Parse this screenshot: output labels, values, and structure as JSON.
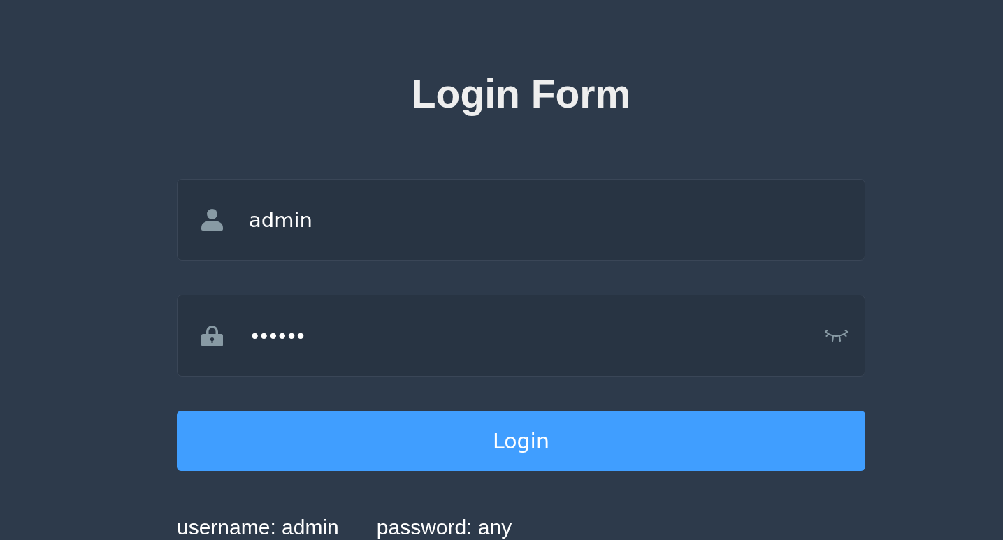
{
  "title": "Login Form",
  "fields": [
    {
      "kind": "text",
      "value": "admin"
    },
    {
      "kind": "password",
      "value": "••••••",
      "revealed": false
    }
  ],
  "button": {
    "label": "Login"
  },
  "tips": [
    "username: admin",
    "password: any"
  ]
}
